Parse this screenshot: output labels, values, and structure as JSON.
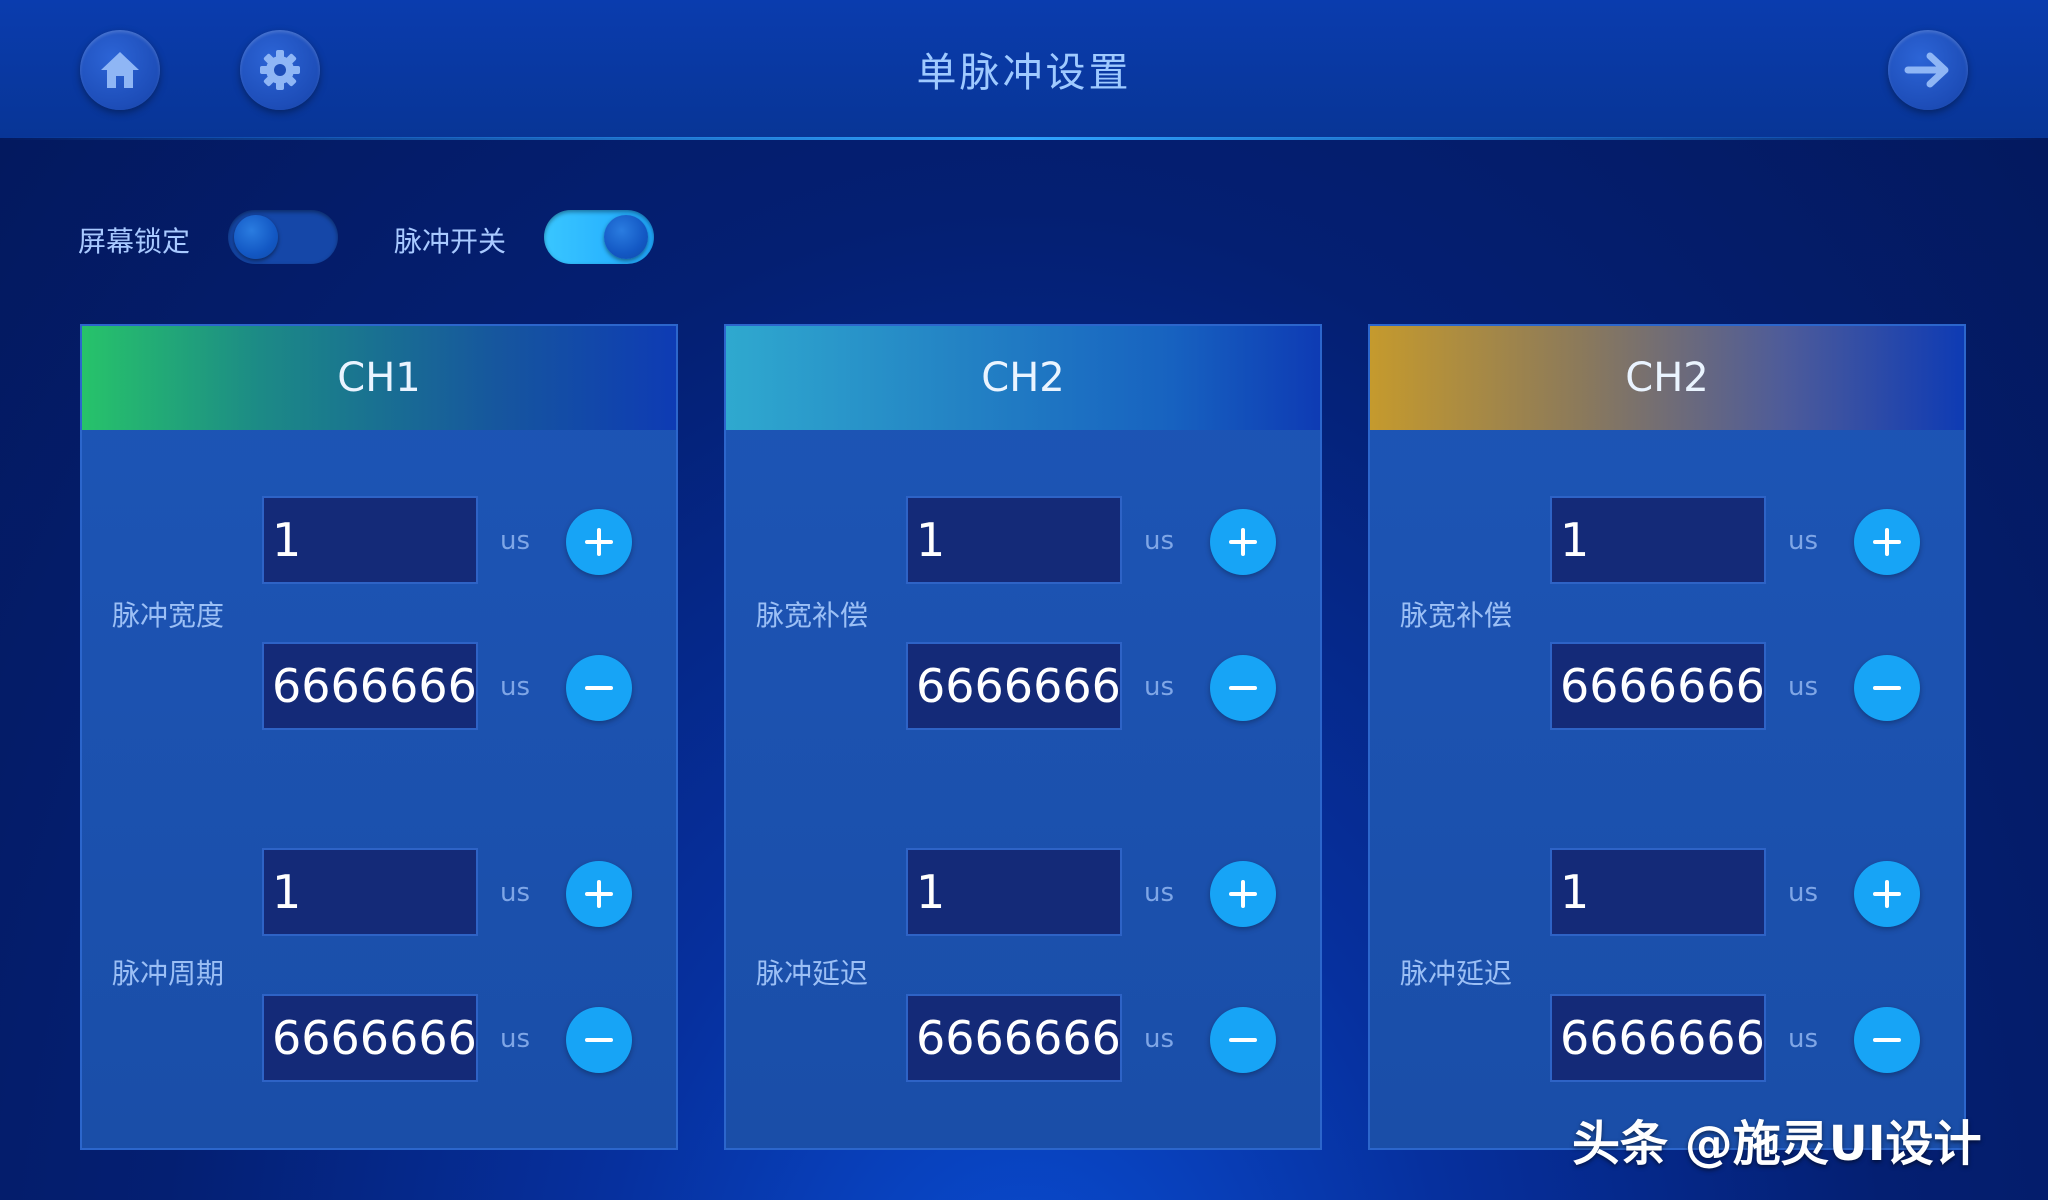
{
  "header": {
    "title": "单脉冲设置",
    "home_icon": "home-icon",
    "settings_icon": "gear-icon",
    "next_icon": "arrow-right-icon"
  },
  "toggles": [
    {
      "label": "屏幕锁定",
      "state": "off"
    },
    {
      "label": "脉冲开关",
      "state": "on"
    }
  ],
  "panels": [
    {
      "title": "CH1",
      "accent": "#27c36a",
      "groups": [
        {
          "label": "脉冲宽度",
          "top_value": "1",
          "bottom_value": "6666666",
          "unit": "us"
        },
        {
          "label": "脉冲周期",
          "top_value": "1",
          "bottom_value": "6666666",
          "unit": "us"
        }
      ]
    },
    {
      "title": "CH2",
      "accent": "#2fa9cf",
      "groups": [
        {
          "label": "脉宽补偿",
          "top_value": "1",
          "bottom_value": "6666666",
          "unit": "us"
        },
        {
          "label": "脉冲延迟",
          "top_value": "1",
          "bottom_value": "6666666",
          "unit": "us"
        }
      ]
    },
    {
      "title": "CH2",
      "accent": "#c59a2d",
      "groups": [
        {
          "label": "脉宽补偿",
          "top_value": "1",
          "bottom_value": "6666666",
          "unit": "us"
        },
        {
          "label": "脉冲延迟",
          "top_value": "1",
          "bottom_value": "6666666",
          "unit": "us"
        }
      ]
    }
  ],
  "watermark": "头条 @施灵UI设计",
  "colors": {
    "background": "#041f72",
    "panel": "#1d55b6",
    "button": "#17a4f6",
    "title": "#9fcaff"
  }
}
